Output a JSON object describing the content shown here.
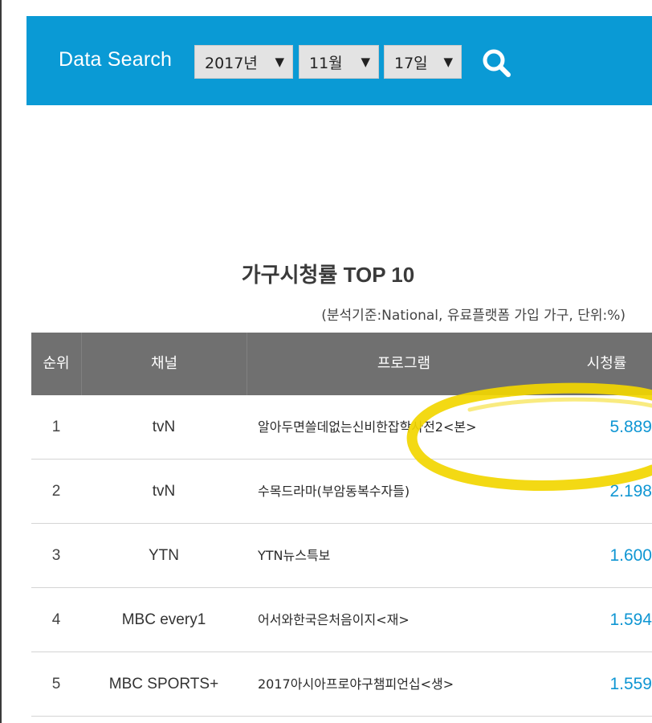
{
  "search": {
    "title": "Data Search",
    "year": "2017년",
    "month": "11월",
    "day": "17일",
    "arrow": "▼"
  },
  "ranking": {
    "title": "가구시청률 TOP 10",
    "subtitle": "(분석기준:National, 유료플랫폼 가입 가구, 단위:%)",
    "headers": {
      "rank": "순위",
      "channel": "채널",
      "program": "프로그램",
      "rating": "시청률"
    },
    "rows": [
      {
        "rank": "1",
        "channel": "tvN",
        "program": "알아두면쓸데없는신비한잡학사전2<본>",
        "rating": "5.889"
      },
      {
        "rank": "2",
        "channel": "tvN",
        "program": "수목드라마(부암동복수자들)",
        "rating": "2.198"
      },
      {
        "rank": "3",
        "channel": "YTN",
        "program": "YTN뉴스특보",
        "rating": "1.600"
      },
      {
        "rank": "4",
        "channel": "MBC every1",
        "program": "어서와한국은처음이지<재>",
        "rating": "1.594"
      },
      {
        "rank": "5",
        "channel": "MBC SPORTS+",
        "program": "2017아시아프로야구챔피언십<생>",
        "rating": "1.559"
      }
    ]
  },
  "colors": {
    "header_bar": "#0a9ad5",
    "table_header": "#707070",
    "rating_text": "#0f96d3",
    "highlight": "#f2d600"
  },
  "icons": {
    "search": "search-icon"
  }
}
